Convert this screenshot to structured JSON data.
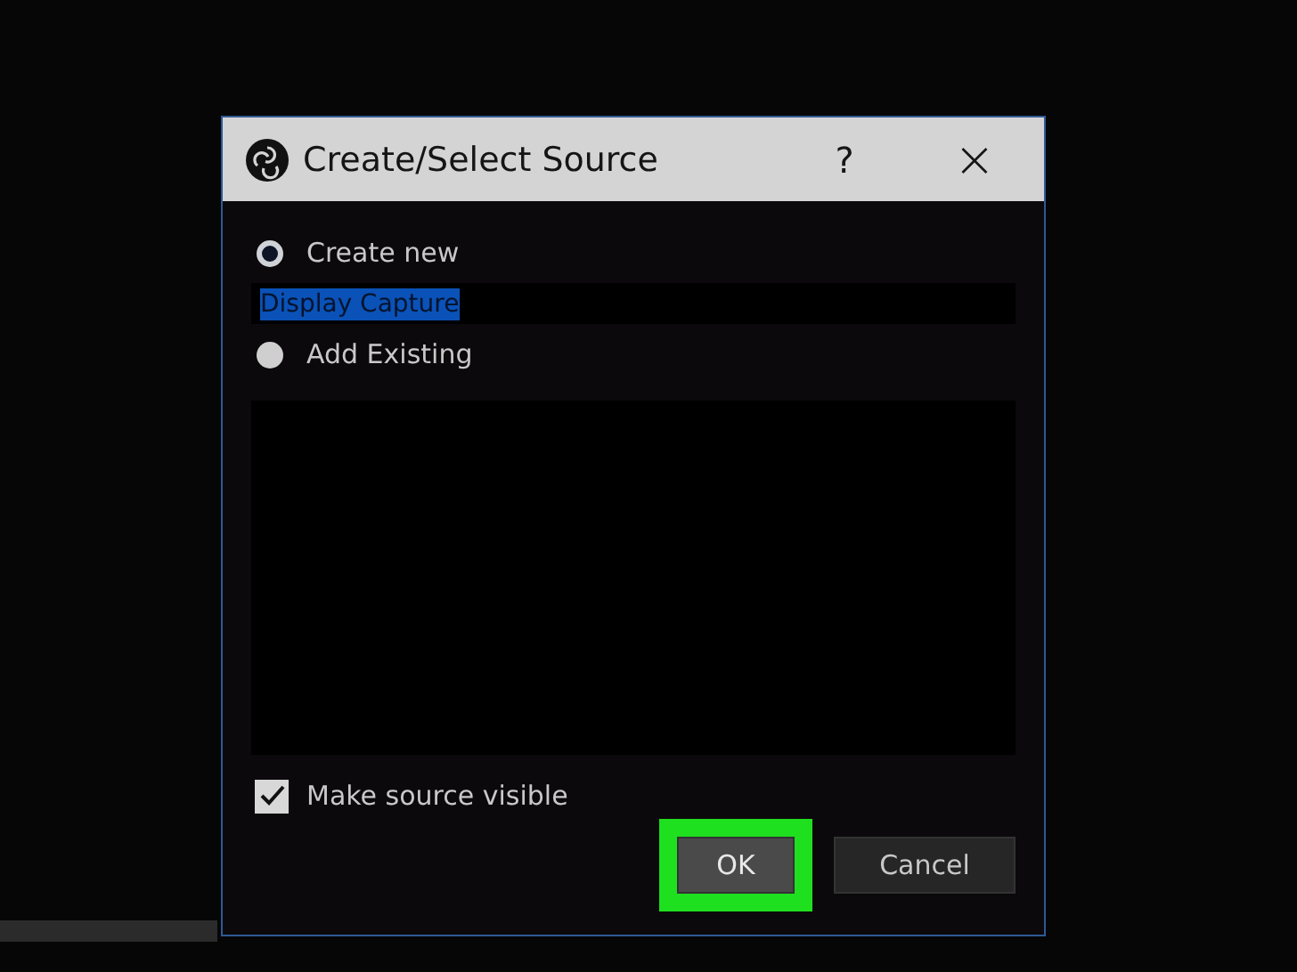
{
  "window": {
    "title": "Create/Select Source"
  },
  "title_buttons": [
    "?",
    "×"
  ],
  "options": [
    {
      "label": "Create new",
      "selected": true
    },
    {
      "label": "Add Existing",
      "selected": false
    }
  ],
  "name_field": {
    "value": "Display Capture",
    "text_selected": true
  },
  "make_visible": {
    "label": "Make source visible",
    "checked": true
  },
  "buttons": [
    {
      "label": "OK",
      "highlighted": true
    },
    {
      "label": "Cancel",
      "highlighted": false
    }
  ]
}
